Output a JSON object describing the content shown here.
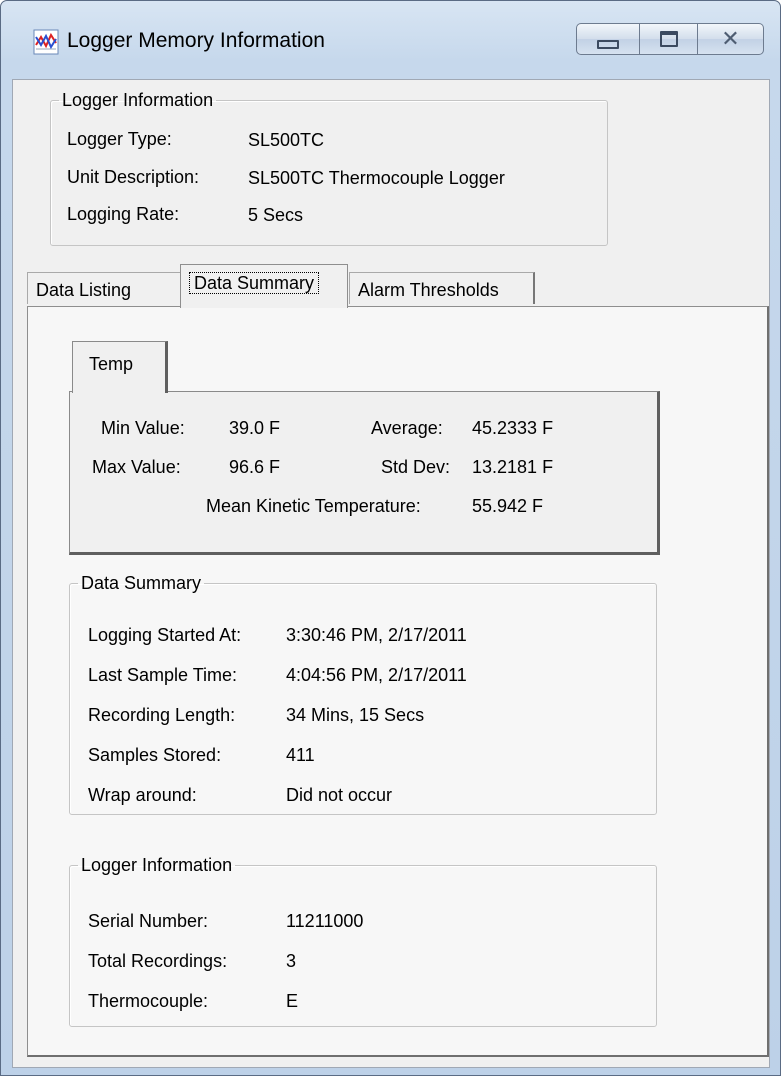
{
  "window": {
    "title": "Logger Memory Information"
  },
  "logger_info_top": {
    "legend": "Logger Information",
    "rows": [
      {
        "label": "Logger Type:",
        "value": "SL500TC"
      },
      {
        "label": "Unit Description:",
        "value": "SL500TC Thermocouple Logger"
      },
      {
        "label": "Logging Rate:",
        "value": "5 Secs"
      }
    ]
  },
  "tabs": [
    {
      "label": "Data Listing",
      "active": false
    },
    {
      "label": "Data Summary",
      "active": true
    },
    {
      "label": "Alarm Thresholds",
      "active": false
    }
  ],
  "temp_tab": {
    "label": "Temp",
    "min_label": "Min Value:",
    "min_value": "39.0 F",
    "max_label": "Max Value:",
    "max_value": "96.6 F",
    "avg_label": "Average:",
    "avg_value": "45.2333 F",
    "std_label": "Std Dev:",
    "std_value": "13.2181 F",
    "mkt_label": "Mean Kinetic Temperature:",
    "mkt_value": "55.942 F"
  },
  "data_summary": {
    "legend": "Data Summary",
    "rows": [
      {
        "label": "Logging Started At:",
        "value": "3:30:46 PM, 2/17/2011"
      },
      {
        "label": "Last Sample Time:",
        "value": "4:04:56 PM, 2/17/2011"
      },
      {
        "label": "Recording Length:",
        "value": "34 Mins, 15 Secs"
      },
      {
        "label": "Samples Stored:",
        "value": "411"
      },
      {
        "label": "Wrap around:",
        "value": "Did not occur"
      }
    ]
  },
  "logger_info_bottom": {
    "legend": "Logger Information",
    "rows": [
      {
        "label": "Serial Number:",
        "value": "11211000"
      },
      {
        "label": "Total Recordings:",
        "value": "3"
      },
      {
        "label": "Thermocouple:",
        "value": "E"
      }
    ]
  }
}
